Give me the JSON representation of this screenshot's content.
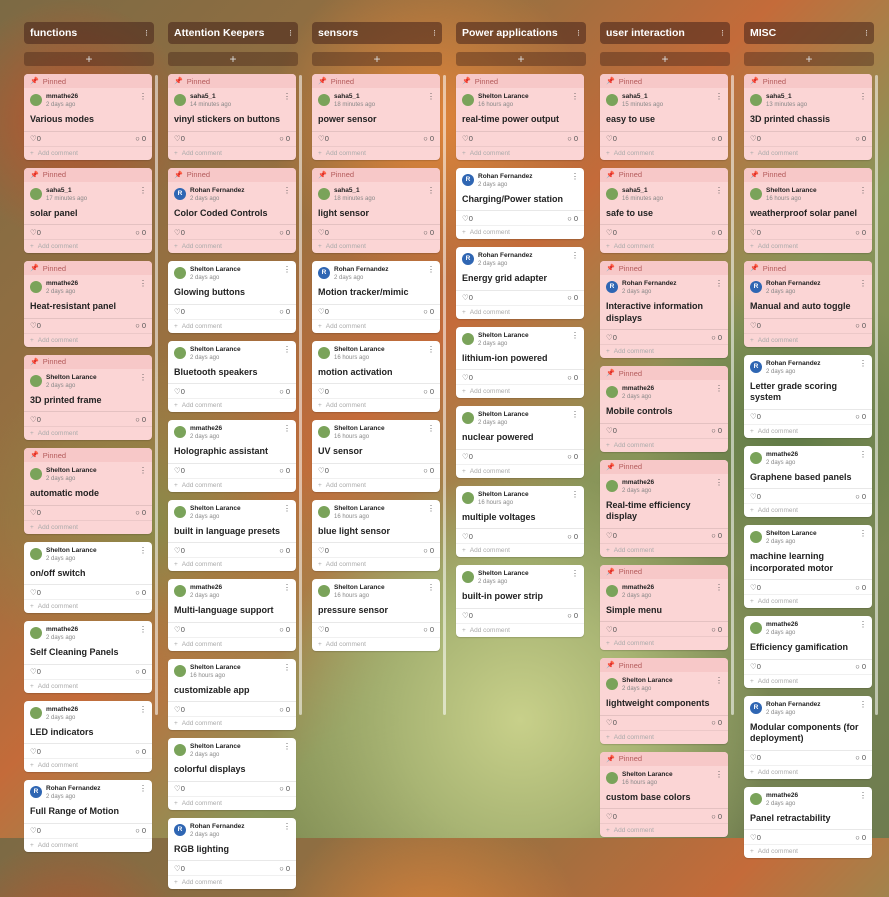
{
  "columns": [
    {
      "title": "functions",
      "cards": [
        {
          "pinned": true,
          "author": "mmathe26",
          "time": "2 days ago",
          "title": "Various modes",
          "likes": "0",
          "comments": "0",
          "avatar": "green"
        },
        {
          "pinned": true,
          "author": "saha5_1",
          "time": "17 minutes ago",
          "title": "solar panel",
          "likes": "0",
          "comments": "0",
          "avatar": "green"
        },
        {
          "pinned": true,
          "author": "mmathe26",
          "time": "2 days ago",
          "title": "Heat-resistant panel",
          "likes": "0",
          "comments": "0",
          "avatar": "green"
        },
        {
          "pinned": true,
          "author": "Shelton Larance",
          "time": "2 days ago",
          "title": "3D printed frame",
          "likes": "0",
          "comments": "0",
          "avatar": "green"
        },
        {
          "pinned": true,
          "author": "Shelton Larance",
          "time": "2 days ago",
          "title": "automatic mode",
          "likes": "0",
          "comments": "0",
          "avatar": "green"
        },
        {
          "pinned": false,
          "author": "Shelton Larance",
          "time": "2 days ago",
          "title": "on/off switch",
          "likes": "0",
          "comments": "0",
          "avatar": "green"
        },
        {
          "pinned": false,
          "author": "mmathe26",
          "time": "2 days ago",
          "title": "Self Cleaning Panels",
          "likes": "0",
          "comments": "0",
          "avatar": "green"
        },
        {
          "pinned": false,
          "author": "mmathe26",
          "time": "2 days ago",
          "title": "LED indicators",
          "likes": "0",
          "comments": "0",
          "avatar": "green"
        },
        {
          "pinned": false,
          "author": "Rohan Fernandez",
          "time": "2 days ago",
          "title": "Full Range of Motion",
          "likes": "0",
          "comments": "0",
          "avatar": "blue"
        }
      ]
    },
    {
      "title": "Attention Keepers",
      "cards": [
        {
          "pinned": true,
          "author": "saha5_1",
          "time": "14 minutes ago",
          "title": "vinyl stickers on buttons",
          "likes": "0",
          "comments": "0",
          "avatar": "green"
        },
        {
          "pinned": true,
          "author": "Rohan Fernandez",
          "time": "2 days ago",
          "title": "Color Coded Controls",
          "likes": "0",
          "comments": "0",
          "avatar": "blue"
        },
        {
          "pinned": false,
          "author": "Shelton Larance",
          "time": "2 days ago",
          "title": "Glowing  buttons",
          "likes": "0",
          "comments": "0",
          "avatar": "green"
        },
        {
          "pinned": false,
          "author": "Shelton Larance",
          "time": "2 days ago",
          "title": "Bluetooth speakers",
          "likes": "0",
          "comments": "0",
          "avatar": "green"
        },
        {
          "pinned": false,
          "author": "mmathe26",
          "time": "2 days ago",
          "title": "Holographic assistant",
          "likes": "0",
          "comments": "0",
          "avatar": "green"
        },
        {
          "pinned": false,
          "author": "Shelton Larance",
          "time": "2 days ago",
          "title": "built in language presets",
          "likes": "0",
          "comments": "0",
          "avatar": "green"
        },
        {
          "pinned": false,
          "author": "mmathe26",
          "time": "2 days ago",
          "title": "Multi-language support",
          "likes": "0",
          "comments": "0",
          "avatar": "green"
        },
        {
          "pinned": false,
          "author": "Shelton Larance",
          "time": "16 hours ago",
          "title": "customizable app",
          "likes": "0",
          "comments": "0",
          "avatar": "green"
        },
        {
          "pinned": false,
          "author": "Shelton Larance",
          "time": "2 days ago",
          "title": "colorful displays",
          "likes": "0",
          "comments": "0",
          "avatar": "green"
        },
        {
          "pinned": false,
          "author": "Rohan Fernandez",
          "time": "2 days ago",
          "title": "RGB lighting",
          "likes": "0",
          "comments": "0",
          "avatar": "blue"
        }
      ]
    },
    {
      "title": "sensors",
      "cards": [
        {
          "pinned": true,
          "author": "saha5_1",
          "time": "18 minutes ago",
          "title": "power sensor",
          "likes": "0",
          "comments": "0",
          "avatar": "green"
        },
        {
          "pinned": true,
          "author": "saha5_1",
          "time": "18 minutes ago",
          "title": "light sensor",
          "likes": "0",
          "comments": "0",
          "avatar": "green"
        },
        {
          "pinned": false,
          "author": "Rohan Fernandez",
          "time": "2 days ago",
          "title": "Motion tracker/mimic",
          "likes": "0",
          "comments": "0",
          "avatar": "blue"
        },
        {
          "pinned": false,
          "author": "Shelton Larance",
          "time": "16 hours ago",
          "title": "motion activation",
          "likes": "0",
          "comments": "0",
          "avatar": "green"
        },
        {
          "pinned": false,
          "author": "Shelton Larance",
          "time": "16 hours ago",
          "title": "UV sensor",
          "likes": "0",
          "comments": "0",
          "avatar": "green"
        },
        {
          "pinned": false,
          "author": "Shelton Larance",
          "time": "16 hours ago",
          "title": "blue light sensor",
          "likes": "0",
          "comments": "0",
          "avatar": "green"
        },
        {
          "pinned": false,
          "author": "Shelton Larance",
          "time": "16 hours ago",
          "title": "pressure sensor",
          "likes": "0",
          "comments": "0",
          "avatar": "green"
        }
      ]
    },
    {
      "title": "Power applications",
      "cards": [
        {
          "pinned": true,
          "author": "Shelton Larance",
          "time": "16 hours ago",
          "title": "real-time power output",
          "likes": "0",
          "comments": "0",
          "avatar": "green"
        },
        {
          "pinned": false,
          "author": "Rohan Fernandez",
          "time": "2 days ago",
          "title": "Charging/Power station",
          "likes": "0",
          "comments": "0",
          "avatar": "blue"
        },
        {
          "pinned": false,
          "author": "Rohan Fernandez",
          "time": "2 days ago",
          "title": "Energy grid adapter",
          "likes": "0",
          "comments": "0",
          "avatar": "blue"
        },
        {
          "pinned": false,
          "author": "Shelton Larance",
          "time": "2 days ago",
          "title": "lithium-ion powered",
          "likes": "0",
          "comments": "0",
          "avatar": "green"
        },
        {
          "pinned": false,
          "author": "Shelton Larance",
          "time": "2 days ago",
          "title": "nuclear powered",
          "likes": "0",
          "comments": "0",
          "avatar": "green"
        },
        {
          "pinned": false,
          "author": "Shelton Larance",
          "time": "16 hours ago",
          "title": "multiple voltages",
          "likes": "0",
          "comments": "0",
          "avatar": "green"
        },
        {
          "pinned": false,
          "author": "Shelton Larance",
          "time": "2 days ago",
          "title": "built-in power strip",
          "likes": "0",
          "comments": "0",
          "avatar": "green"
        }
      ]
    },
    {
      "title": "user interaction",
      "cards": [
        {
          "pinned": true,
          "author": "saha5_1",
          "time": "15 minutes ago",
          "title": "easy to use",
          "likes": "0",
          "comments": "0",
          "avatar": "green"
        },
        {
          "pinned": true,
          "author": "saha5_1",
          "time": "16 minutes ago",
          "title": "safe to use",
          "likes": "0",
          "comments": "0",
          "avatar": "green"
        },
        {
          "pinned": true,
          "author": "Rohan Fernandez",
          "time": "2 days ago",
          "title": "Interactive information displays",
          "likes": "0",
          "comments": "0",
          "avatar": "blue"
        },
        {
          "pinned": true,
          "author": "mmathe26",
          "time": "2 days ago",
          "title": "Mobile controls",
          "likes": "0",
          "comments": "0",
          "avatar": "green"
        },
        {
          "pinned": true,
          "author": "mmathe26",
          "time": "2 days ago",
          "title": "Real-time efficiency display",
          "likes": "0",
          "comments": "0",
          "avatar": "green"
        },
        {
          "pinned": true,
          "author": "mmathe26",
          "time": "2 days ago",
          "title": "Simple menu",
          "likes": "0",
          "comments": "0",
          "avatar": "green"
        },
        {
          "pinned": true,
          "author": "Shelton Larance",
          "time": "2 days ago",
          "title": "lightweight components",
          "likes": "0",
          "comments": "0",
          "avatar": "green"
        },
        {
          "pinned": true,
          "author": "Shelton Larance",
          "time": "16 hours ago",
          "title": "custom base colors",
          "likes": "0",
          "comments": "0",
          "avatar": "green"
        }
      ]
    },
    {
      "title": "MISC",
      "cards": [
        {
          "pinned": true,
          "author": "saha5_1",
          "time": "13 minutes ago",
          "title": "3D printed chassis",
          "likes": "0",
          "comments": "0",
          "avatar": "green"
        },
        {
          "pinned": true,
          "author": "Shelton Larance",
          "time": "16 hours ago",
          "title": "weatherproof solar panel",
          "likes": "0",
          "comments": "0",
          "avatar": "green"
        },
        {
          "pinned": true,
          "author": "Rohan Fernandez",
          "time": "2 days ago",
          "title": "Manual and auto toggle",
          "likes": "0",
          "comments": "0",
          "avatar": "blue"
        },
        {
          "pinned": false,
          "author": "Rohan Fernandez",
          "time": "2 days ago",
          "title": "Letter grade scoring system",
          "likes": "0",
          "comments": "0",
          "avatar": "blue"
        },
        {
          "pinned": false,
          "author": "mmathe26",
          "time": "2 days ago",
          "title": "Graphene based panels",
          "likes": "0",
          "comments": "0",
          "avatar": "green"
        },
        {
          "pinned": false,
          "author": "Shelton Larance",
          "time": "2 days ago",
          "title": "machine learning incorporated motor",
          "likes": "0",
          "comments": "0",
          "avatar": "green"
        },
        {
          "pinned": false,
          "author": "mmathe26",
          "time": "2 days ago",
          "title": "Efficiency gamification",
          "likes": "0",
          "comments": "0",
          "avatar": "green"
        },
        {
          "pinned": false,
          "author": "Rohan Fernandez",
          "time": "2 days ago",
          "title": "Modular components (for deployment)",
          "likes": "0",
          "comments": "0",
          "avatar": "blue"
        },
        {
          "pinned": false,
          "author": "mmathe26",
          "time": "2 days ago",
          "title": "Panel retractability",
          "likes": "0",
          "comments": "0",
          "avatar": "green"
        }
      ]
    }
  ],
  "labels": {
    "pinned": "Pinned",
    "add_comment": "Add comment",
    "add_card": "+"
  },
  "icons": {
    "pin": "pin-icon",
    "heart": "heart-icon",
    "comment": "comment-icon",
    "kebab": "kebab-icon",
    "add": "plus-icon"
  },
  "colors": {
    "pinned_bg": "#fbd5d5",
    "card_bg": "#ffffff",
    "header_bg": "#5a2e22",
    "avatar_green": "#7aa35a",
    "avatar_blue": "#2f66b3"
  }
}
